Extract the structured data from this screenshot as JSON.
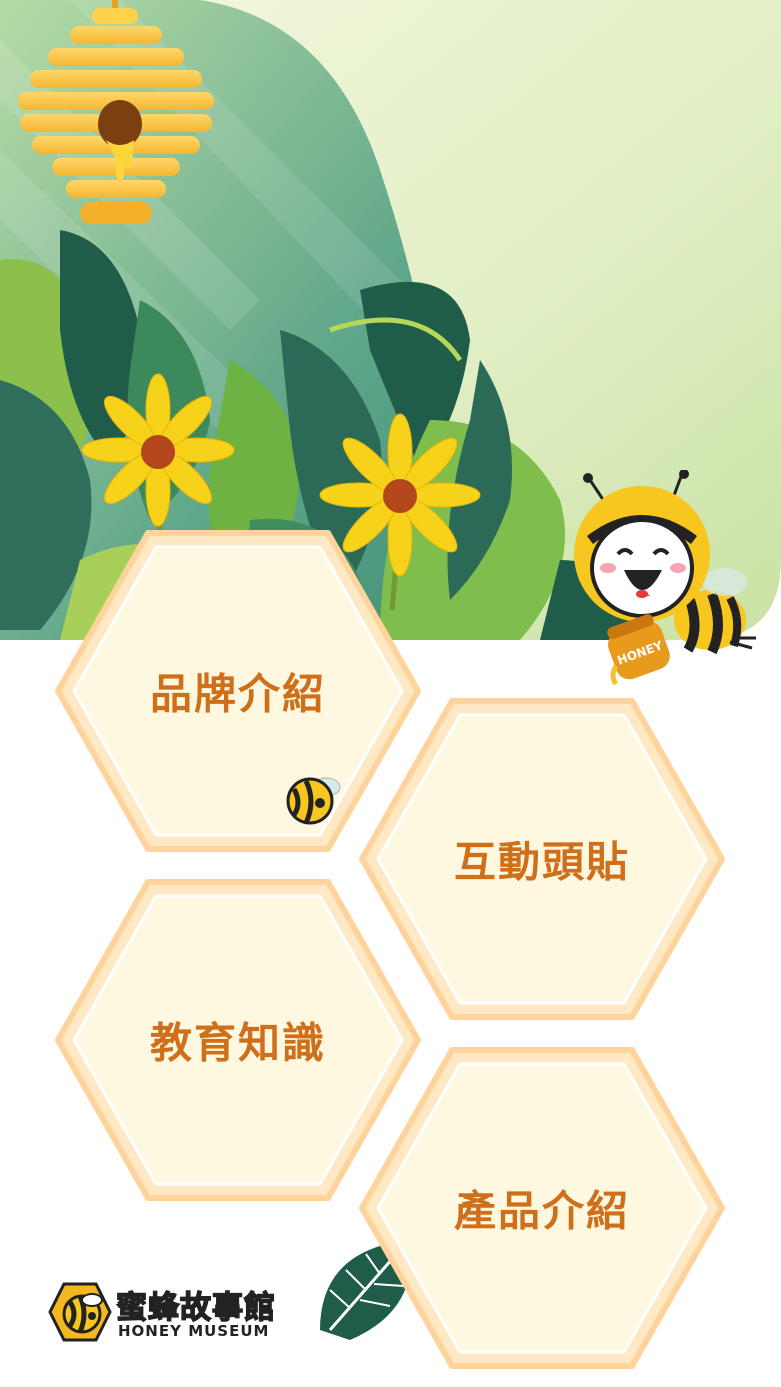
{
  "menu": {
    "items": [
      {
        "label": "品牌介紹"
      },
      {
        "label": "互動頭貼"
      },
      {
        "label": "教育知識"
      },
      {
        "label": "產品介紹"
      }
    ]
  },
  "logo": {
    "title": "蜜蜂故事館",
    "subtitle": "HONEY MUSEUM"
  },
  "mascot": {
    "jar_text": "HONEY"
  },
  "colors": {
    "accent_text": "#cf6f1a",
    "hex_fill": "#fff8e0",
    "hex_border": "#ffdcaa",
    "honey_yellow": "#f6c12a"
  }
}
